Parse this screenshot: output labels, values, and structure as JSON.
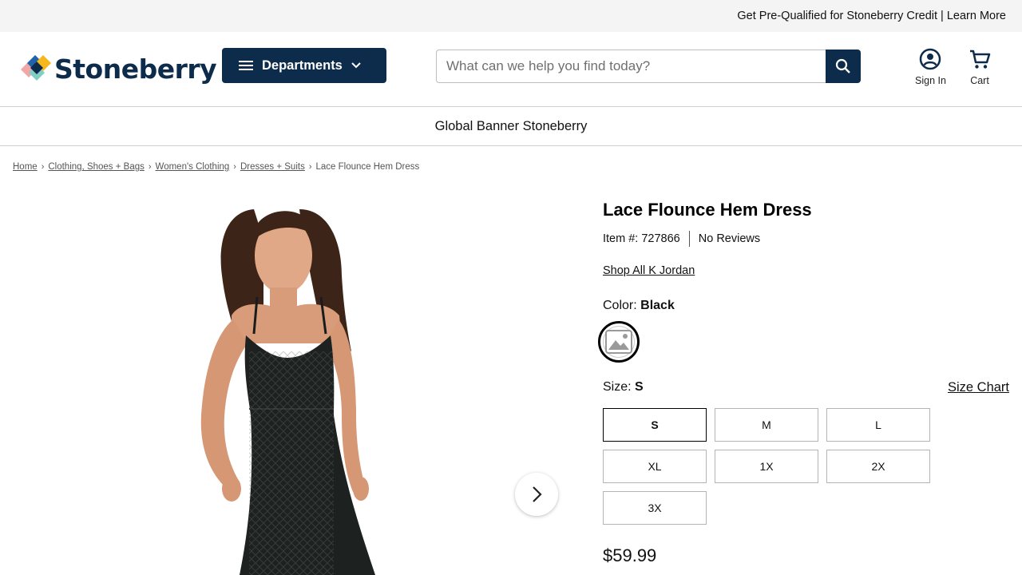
{
  "promo": {
    "text": "Get Pre-Qualified for Stoneberry Credit | Learn More"
  },
  "header": {
    "logo_text": "Stoneberry",
    "departments_label": "Departments",
    "search_placeholder": "What can we help you find today?",
    "sign_in_label": "Sign In",
    "cart_label": "Cart",
    "brand_color": "#0d2b4a"
  },
  "global_banner": {
    "text": "Global Banner Stoneberry"
  },
  "breadcrumb": {
    "items": [
      "Home",
      "Clothing, Shoes + Bags",
      "Women's Clothing",
      "Dresses + Suits"
    ],
    "current": "Lace Flounce Hem Dress"
  },
  "product": {
    "title": "Lace Flounce Hem Dress",
    "item_number": "Item #: 727866",
    "reviews": "No Reviews",
    "shop_all": "Shop All K Jordan",
    "color_label": "Color:",
    "color_value": "Black",
    "size_label": "Size:",
    "size_value": "S",
    "size_chart_label": "Size Chart",
    "sizes": [
      "S",
      "M",
      "L",
      "XL",
      "1X",
      "2X",
      "3X"
    ],
    "selected_size": "S",
    "price": "$59.99"
  },
  "icons": {
    "menu": "menu-icon",
    "chevron": "chevron-down-icon",
    "search": "search-icon",
    "account": "account-circle-icon",
    "cart": "cart-icon",
    "next": "chevron-right-icon",
    "swatch_placeholder": "image-placeholder-icon"
  }
}
